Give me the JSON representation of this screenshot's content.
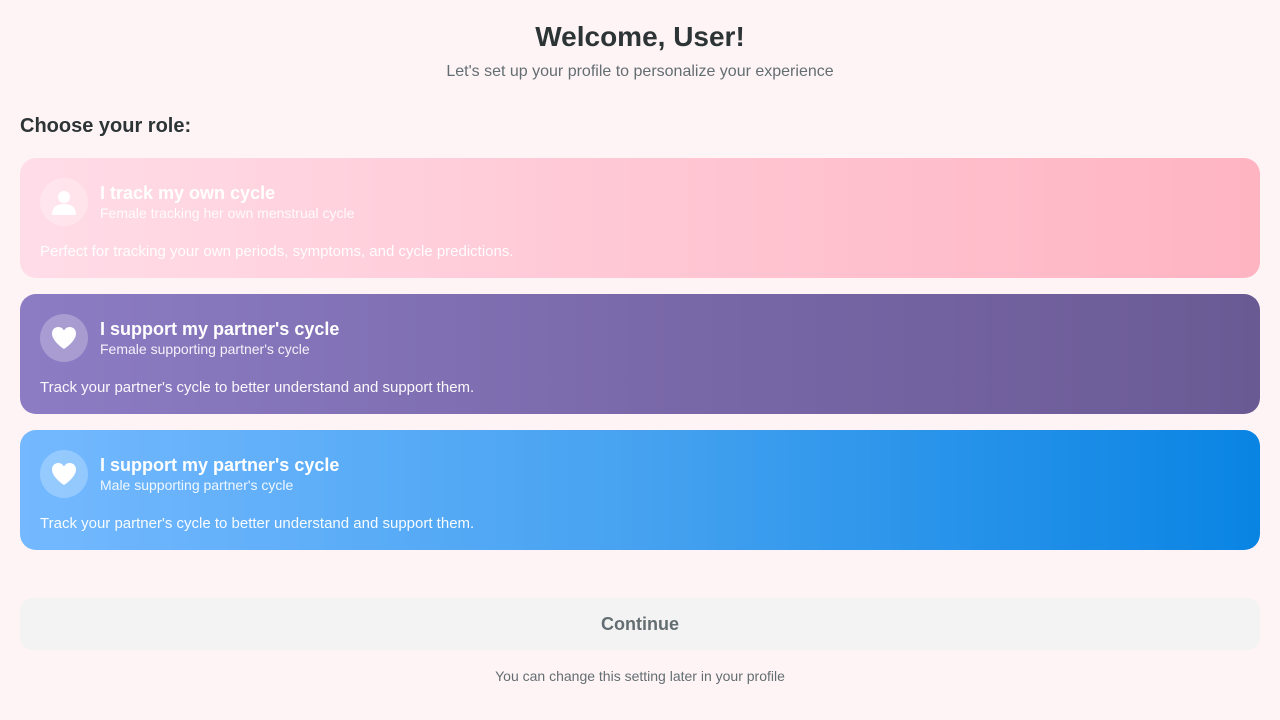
{
  "header": {
    "title": "Welcome, User!",
    "subtitle": "Let's set up your profile to personalize your experience"
  },
  "role_section": {
    "title": "Choose your role:",
    "options": [
      {
        "icon": "person-icon",
        "title": "I track my own cycle",
        "subtitle": "Female tracking her own menstrual cycle",
        "description": "Perfect for tracking your own periods, symptoms, and cycle predictions.",
        "colors": [
          "#ffdde8",
          "#ffb4c2"
        ]
      },
      {
        "icon": "heart-icon",
        "title": "I support my partner's cycle",
        "subtitle": "Female supporting partner's cycle",
        "description": "Track your partner's cycle to better understand and support them.",
        "colors": [
          "#8c7cc4",
          "#6a5a94"
        ]
      },
      {
        "icon": "heart-icon",
        "title": "I support my partner's cycle",
        "subtitle": "Male supporting partner's cycle",
        "description": "Track your partner's cycle to better understand and support them.",
        "colors": [
          "#74b9ff",
          "#0984e3"
        ]
      }
    ]
  },
  "footer": {
    "continue_label": "Continue",
    "note": "You can change this setting later in your profile"
  }
}
